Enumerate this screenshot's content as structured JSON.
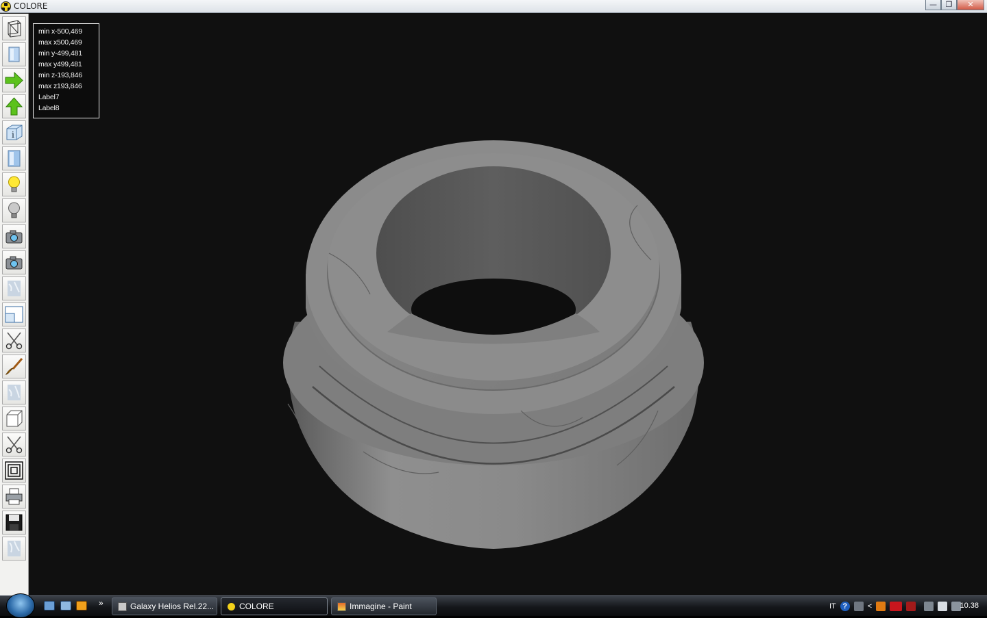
{
  "window": {
    "title": "COLORE",
    "buttons": {
      "minimize": "—",
      "restore": "❐",
      "close": "✕"
    }
  },
  "toolbar": {
    "tools": [
      {
        "name": "wireframe-view-icon"
      },
      {
        "name": "solid-view-icon"
      },
      {
        "name": "arrow-right-icon"
      },
      {
        "name": "arrow-up-icon"
      },
      {
        "name": "box-info-icon"
      },
      {
        "name": "solid-shaded-icon"
      },
      {
        "name": "light-on-icon"
      },
      {
        "name": "light-off-icon"
      },
      {
        "name": "camera-icon"
      },
      {
        "name": "camera-alt-icon"
      },
      {
        "name": "marble-texture-icon"
      },
      {
        "name": "window-frame-icon"
      },
      {
        "name": "scissors-icon"
      },
      {
        "name": "paint-brush-icon"
      },
      {
        "name": "marble-texture-alt-icon"
      },
      {
        "name": "cube-icon"
      },
      {
        "name": "scissors-alt-icon"
      },
      {
        "name": "concentric-squares-icon"
      },
      {
        "name": "printer-icon"
      },
      {
        "name": "floppy-disk-icon"
      },
      {
        "name": "marble-texture-third-icon"
      }
    ]
  },
  "info": {
    "min_x": "min x-500,469",
    "max_x": "max x500,469",
    "min_y": "min y-499,481",
    "max_y": "max y499,481",
    "min_z": "min z-193,846",
    "max_z": "max z193,846",
    "label7": "Label7",
    "label8": "Label8"
  },
  "taskbar": {
    "more": "»",
    "buttons": [
      {
        "label": "Galaxy Helios  Rel.22...",
        "active": false
      },
      {
        "label": "COLORE",
        "active": true
      },
      {
        "label": "Immagine - Paint",
        "active": false
      }
    ],
    "tray": {
      "language": "IT",
      "help": "?",
      "arrow": "<"
    },
    "clock": "10.38"
  },
  "colors": {
    "background": "#101010",
    "marble": "#8a8a8a",
    "accent_green": "#5cc21c"
  }
}
